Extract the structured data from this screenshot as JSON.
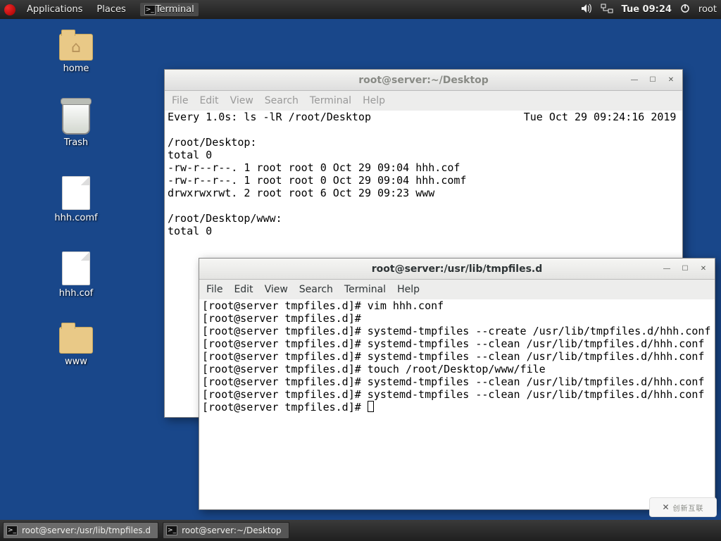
{
  "panel": {
    "apps": "Applications",
    "places": "Places",
    "active_app": "Terminal",
    "clock": "Tue 09:24",
    "user": "root"
  },
  "desktop": {
    "icons": [
      {
        "label": "home",
        "kind": "home-folder"
      },
      {
        "label": "Trash",
        "kind": "trash"
      },
      {
        "label": "hhh.comf",
        "kind": "file"
      },
      {
        "label": "hhh.cof",
        "kind": "file"
      },
      {
        "label": "www",
        "kind": "folder"
      }
    ]
  },
  "menus": {
    "file": "File",
    "edit": "Edit",
    "view": "View",
    "search": "Search",
    "terminal": "Terminal",
    "help": "Help"
  },
  "win1": {
    "title": "root@server:~/Desktop",
    "watch_left": "Every 1.0s: ls -lR /root/Desktop",
    "watch_right": "Tue Oct 29 09:24:16 2019",
    "body": "/root/Desktop:\ntotal 0\n-rw-r--r--. 1 root root 0 Oct 29 09:04 hhh.cof\n-rw-r--r--. 1 root root 0 Oct 29 09:04 hhh.comf\ndrwxrwxrwt. 2 root root 6 Oct 29 09:23 www\n\n/root/Desktop/www:\ntotal 0"
  },
  "win2": {
    "title": "root@server:/usr/lib/tmpfiles.d",
    "lines": [
      "[root@server tmpfiles.d]# vim hhh.conf",
      "[root@server tmpfiles.d]#",
      "[root@server tmpfiles.d]# systemd-tmpfiles --create /usr/lib/tmpfiles.d/hhh.conf",
      "[root@server tmpfiles.d]# systemd-tmpfiles --clean /usr/lib/tmpfiles.d/hhh.conf",
      "[root@server tmpfiles.d]# systemd-tmpfiles --clean /usr/lib/tmpfiles.d/hhh.conf",
      "[root@server tmpfiles.d]# touch /root/Desktop/www/file",
      "[root@server tmpfiles.d]# systemd-tmpfiles --clean /usr/lib/tmpfiles.d/hhh.conf",
      "[root@server tmpfiles.d]# systemd-tmpfiles --clean /usr/lib/tmpfiles.d/hhh.conf",
      "[root@server tmpfiles.d]# "
    ]
  },
  "taskbar": {
    "items": [
      {
        "label": "root@server:/usr/lib/tmpfiles.d",
        "active": true
      },
      {
        "label": "root@server:~/Desktop",
        "active": false
      }
    ]
  },
  "watermark": {
    "brand": "创新互联"
  }
}
